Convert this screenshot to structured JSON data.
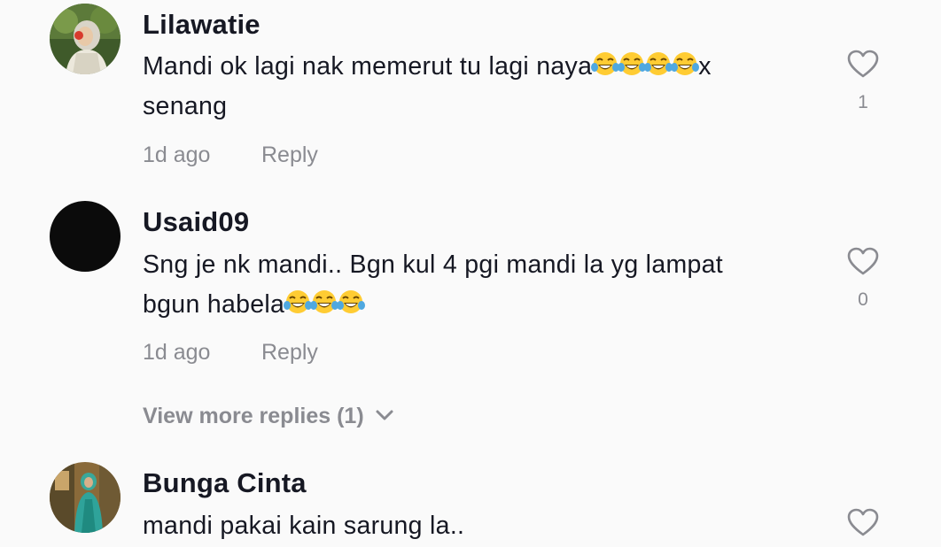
{
  "comments": [
    {
      "username": "Lilawatie",
      "text_part1": "Mandi ok lagi nak memerut tu lagi naya",
      "text_part2": "x",
      "text_part3": "senang",
      "emoji_name": "face-with-tears-of-joy",
      "emoji_count": 4,
      "time": "1d ago",
      "reply_label": "Reply",
      "likes": "1"
    },
    {
      "username": "Usaid09",
      "text_part1": "Sng je nk mandi.. Bgn kul 4 pgi mandi la yg lampat",
      "text_part2": "bgun habela",
      "emoji_name": "face-with-tears-of-joy",
      "emoji_count": 3,
      "time": "1d ago",
      "reply_label": "Reply",
      "likes": "0"
    },
    {
      "username": "Bunga Cinta",
      "text_part1": "mandi pakai kain sarung la.."
    }
  ],
  "view_more_replies": "View more replies (1)",
  "colors": {
    "background": "#fafafa",
    "text_primary": "#161823",
    "text_secondary": "#8a8b91"
  },
  "icons": {
    "like": "heart-outline-icon",
    "expand": "chevron-down-icon"
  }
}
